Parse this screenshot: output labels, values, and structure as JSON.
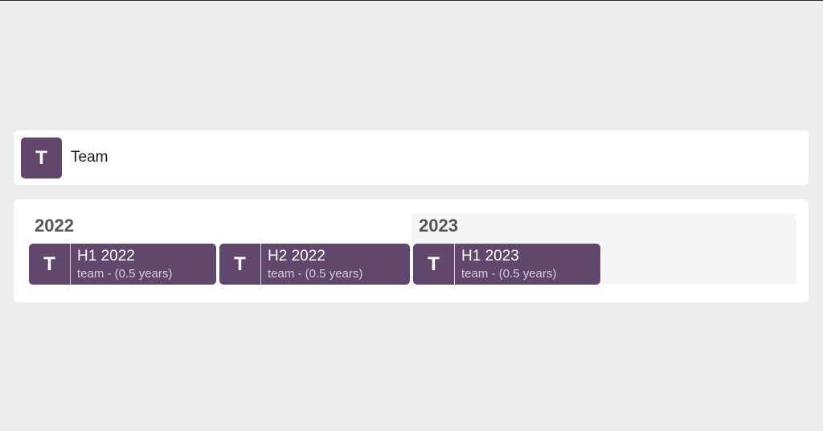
{
  "header": {
    "avatar_letter": "T",
    "name": "Team"
  },
  "timeline": {
    "years": [
      {
        "label": "2022"
      },
      {
        "label": "2023"
      }
    ],
    "periods": [
      {
        "icon_letter": "T",
        "title": "H1 2022",
        "subtitle": "team - (0.5 years)"
      },
      {
        "icon_letter": "T",
        "title": "H2 2022",
        "subtitle": "team - (0.5 years)"
      },
      {
        "icon_letter": "T",
        "title": "H1 2023",
        "subtitle": "team - (0.5 years)"
      }
    ]
  },
  "colors": {
    "accent": "#60476b",
    "background": "#ededed",
    "card": "#ffffff",
    "year_label": "#555555"
  }
}
